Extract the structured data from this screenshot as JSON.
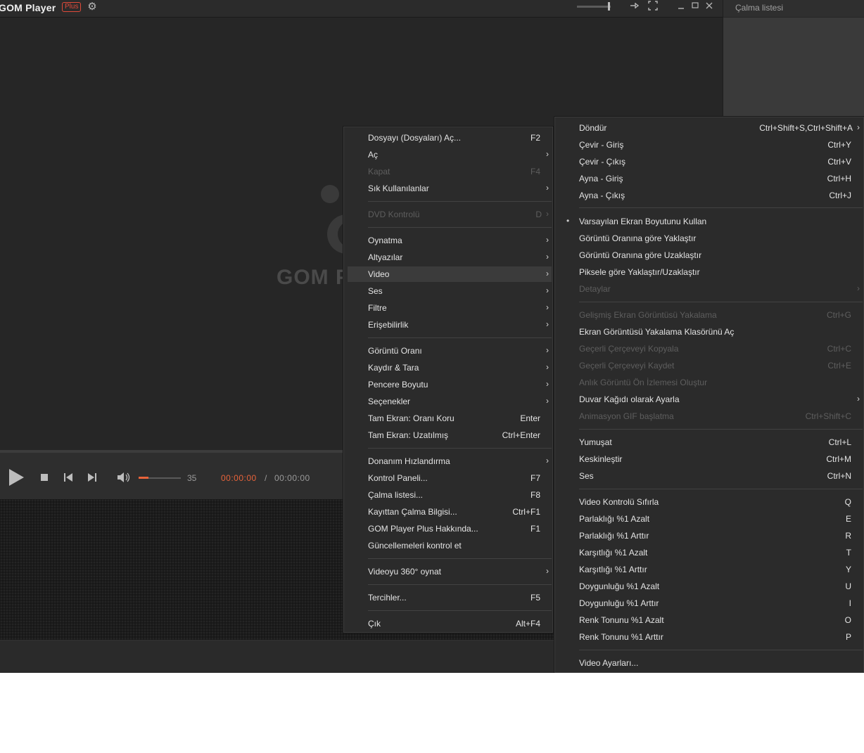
{
  "window": {
    "app_title": "GOM Player",
    "plus_badge": "Plus"
  },
  "playlist": {
    "title": "Çalma listesi"
  },
  "video": {
    "logo_text": "GOM P"
  },
  "controls": {
    "volume_value": "35",
    "time_current": "00:00:00",
    "time_separator": "/",
    "time_total": "00:00:00",
    "volume_level": 0.23,
    "accent_color": "#e8633a"
  },
  "main_menu": {
    "items": [
      {
        "label": "Dosyayı (Dosyaları) Aç...",
        "shortcut": "F2"
      },
      {
        "label": "Aç",
        "submenu": true
      },
      {
        "label": "Kapat",
        "shortcut": "F4",
        "disabled": true
      },
      {
        "label": "Sık Kullanılanlar",
        "submenu": true
      },
      {
        "label": "DVD Kontrolü",
        "shortcut": "D",
        "submenu": true,
        "disabled": true
      },
      {
        "label": "Oynatma",
        "submenu": true
      },
      {
        "label": "Altyazılar",
        "submenu": true
      },
      {
        "label": "Video",
        "submenu": true,
        "highlighted": true
      },
      {
        "label": "Ses",
        "submenu": true
      },
      {
        "label": "Filtre",
        "submenu": true
      },
      {
        "label": "Erişebilirlik",
        "submenu": true
      },
      {
        "label": "Görüntü Oranı",
        "submenu": true
      },
      {
        "label": "Kaydır & Tara",
        "submenu": true
      },
      {
        "label": "Pencere Boyutu",
        "submenu": true
      },
      {
        "label": "Seçenekler",
        "submenu": true
      },
      {
        "label": "Tam Ekran: Oranı Koru",
        "shortcut": "Enter"
      },
      {
        "label": "Tam Ekran: Uzatılmış",
        "shortcut": "Ctrl+Enter"
      },
      {
        "label": "Donanım Hızlandırma",
        "submenu": true
      },
      {
        "label": "Kontrol Paneli...",
        "shortcut": "F7"
      },
      {
        "label": "Çalma listesi...",
        "shortcut": "F8"
      },
      {
        "label": "Kayıttan Çalma Bilgisi...",
        "shortcut": "Ctrl+F1"
      },
      {
        "label": "GOM Player Plus Hakkında...",
        "shortcut": "F1"
      },
      {
        "label": "Güncellemeleri kontrol et"
      },
      {
        "label": "Videoyu 360° oynat",
        "submenu": true
      },
      {
        "label": "Tercihler...",
        "shortcut": "F5"
      },
      {
        "label": "Çık",
        "shortcut": "Alt+F4"
      }
    ]
  },
  "video_menu": {
    "items": [
      {
        "label": "Döndür",
        "shortcut": "Ctrl+Shift+S,Ctrl+Shift+A",
        "submenu": true
      },
      {
        "label": "Çevir - Giriş",
        "shortcut": "Ctrl+Y"
      },
      {
        "label": "Çevir - Çıkış",
        "shortcut": "Ctrl+V"
      },
      {
        "label": "Ayna - Giriş",
        "shortcut": "Ctrl+H"
      },
      {
        "label": "Ayna - Çıkış",
        "shortcut": "Ctrl+J"
      },
      {
        "label": "Varsayılan Ekran Boyutunu Kullan",
        "checked": true
      },
      {
        "label": "Görüntü Oranına göre Yaklaştır"
      },
      {
        "label": "Görüntü Oranına göre Uzaklaştır"
      },
      {
        "label": "Piksele göre Yaklaştır/Uzaklaştır"
      },
      {
        "label": "Detaylar",
        "submenu": true,
        "disabled": true
      },
      {
        "label": "Gelişmiş Ekran Görüntüsü Yakalama",
        "shortcut": "Ctrl+G",
        "disabled": true
      },
      {
        "label": "Ekran Görüntüsü Yakalama Klasörünü Aç"
      },
      {
        "label": "Geçerli Çerçeveyi Kopyala",
        "shortcut": "Ctrl+C",
        "disabled": true
      },
      {
        "label": "Geçerli Çerçeveyi Kaydet",
        "shortcut": "Ctrl+E",
        "disabled": true
      },
      {
        "label": "Anlık Görüntü Ön İzlemesi Oluştur",
        "disabled": true
      },
      {
        "label": "Duvar Kağıdı olarak Ayarla",
        "submenu": true
      },
      {
        "label": "Animasyon GIF başlatma",
        "shortcut": "Ctrl+Shift+C",
        "disabled": true
      },
      {
        "label": "Yumuşat",
        "shortcut": "Ctrl+L"
      },
      {
        "label": "Keskinleştir",
        "shortcut": "Ctrl+M"
      },
      {
        "label": "Ses",
        "shortcut": "Ctrl+N"
      },
      {
        "label": "Video Kontrolü Sıfırla",
        "shortcut": "Q"
      },
      {
        "label": "Parlaklığı %1 Azalt",
        "shortcut": "E"
      },
      {
        "label": "Parlaklığı %1 Arttır",
        "shortcut": "R"
      },
      {
        "label": "Karşıtlığı %1 Azalt",
        "shortcut": "T"
      },
      {
        "label": "Karşıtlığı %1 Arttır",
        "shortcut": "Y"
      },
      {
        "label": "Doygunluğu %1 Azalt",
        "shortcut": "U"
      },
      {
        "label": "Doygunluğu %1 Arttır",
        "shortcut": "I"
      },
      {
        "label": "Renk Tonunu %1 Azalt",
        "shortcut": "O"
      },
      {
        "label": "Renk Tonunu %1 Arttır",
        "shortcut": "P"
      },
      {
        "label": "Video Ayarları..."
      }
    ]
  }
}
